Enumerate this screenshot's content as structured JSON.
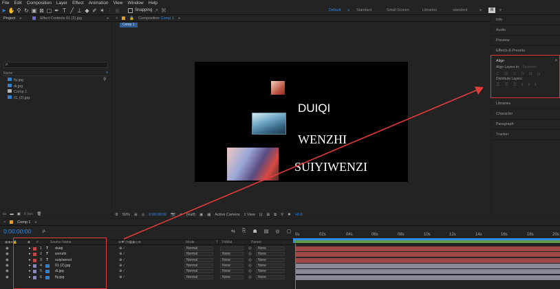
{
  "menu": [
    "File",
    "Edit",
    "Composition",
    "Layer",
    "Effect",
    "Animation",
    "View",
    "Window",
    "Help"
  ],
  "toolbar": {
    "snapping": "Snapping"
  },
  "workspaces": [
    "Default",
    "Standard",
    "Small Screen",
    "Libraries",
    "standard"
  ],
  "project": {
    "tab": "Project",
    "effect_controls": "Effect Controls 01 (2).jpg",
    "search_placeholder": "ρ.",
    "col_name": "Name",
    "items": [
      "fly.jpg",
      "di.jpg",
      "Comp 1",
      "01 (2).jpg"
    ],
    "bpc": "8 bpc"
  },
  "composition": {
    "tab_prefix": "Composition",
    "tab_name": "Comp 1",
    "comp_tab": "Comp 1",
    "zoom": "50%",
    "timecode": "0:00:00:00",
    "resolution": "(Half)",
    "camera": "Active Camera",
    "view": "1 View",
    "exposure": "+0.0"
  },
  "canvas_text": [
    "DUIQI",
    "WENZHI",
    "SUIYIWENZI"
  ],
  "right_panel": {
    "items": [
      "Info",
      "Audio",
      "Preview",
      "Effects & Presets"
    ],
    "align_title": "Align",
    "align_to_label": "Align Layers to:",
    "align_to_value": "Selection",
    "distribute": "Distribute Layers:",
    "lower": [
      "Libraries",
      "Character",
      "Paragraph",
      "Tracker"
    ]
  },
  "timeline": {
    "tab": "Comp 1",
    "timecode": "0:00:00:00",
    "cols": {
      "num": "#",
      "source": "Source Name",
      "mode": "Mode",
      "t": "T",
      "trkmat": "TrkMat",
      "parent": "Parent"
    },
    "ruler": [
      "0s",
      "02s",
      "04s",
      "06s",
      "08s",
      "10s",
      "12s",
      "14s",
      "16s",
      "18s",
      "20s"
    ],
    "layers": [
      {
        "num": "1",
        "type": "T",
        "name": "duiqi",
        "mode": "Normal",
        "trkmat": "",
        "parent": "None"
      },
      {
        "num": "2",
        "type": "T",
        "name": "wenzhi",
        "mode": "Normal",
        "trkmat": "None",
        "parent": "None"
      },
      {
        "num": "3",
        "type": "T",
        "name": "suiyiwenzi",
        "mode": "Normal",
        "trkmat": "None",
        "parent": "None"
      },
      {
        "num": "4",
        "type": "img",
        "name": "01 (2).jpg",
        "mode": "Normal",
        "trkmat": "None",
        "parent": "None"
      },
      {
        "num": "5",
        "type": "img",
        "name": "di.jpg",
        "mode": "Normal",
        "trkmat": "None",
        "parent": "None"
      },
      {
        "num": "6",
        "type": "img",
        "name": "fly.jpg",
        "mode": "Normal",
        "trkmat": "None",
        "parent": "None"
      }
    ]
  },
  "colors": {
    "accent": "#2d8ceb",
    "highlight": "#e23b3b",
    "text_layer_bar": "#a04848",
    "image_layer_bar": "#8a8a9a",
    "work_area": "#5e9b48"
  }
}
